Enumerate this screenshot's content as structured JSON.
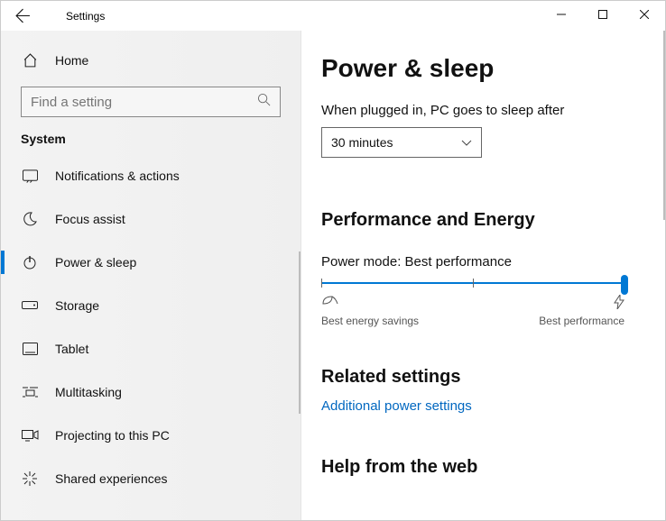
{
  "titlebar": {
    "app_title": "Settings"
  },
  "sidebar": {
    "home_label": "Home",
    "search_placeholder": "Find a setting",
    "category": "System",
    "items": [
      {
        "label": "Notifications & actions",
        "icon": "notifications"
      },
      {
        "label": "Focus assist",
        "icon": "moon"
      },
      {
        "label": "Power & sleep",
        "icon": "power",
        "selected": true
      },
      {
        "label": "Storage",
        "icon": "storage"
      },
      {
        "label": "Tablet",
        "icon": "tablet"
      },
      {
        "label": "Multitasking",
        "icon": "multitasking"
      },
      {
        "label": "Projecting to this PC",
        "icon": "projecting"
      },
      {
        "label": "Shared experiences",
        "icon": "shared"
      }
    ]
  },
  "main": {
    "title": "Power & sleep",
    "sleep_label": "When plugged in, PC goes to sleep after",
    "sleep_value": "30 minutes",
    "perf_heading": "Performance and Energy",
    "power_mode_prefix": "Power mode: ",
    "power_mode_value": "Best performance",
    "slider_left_label": "Best energy savings",
    "slider_right_label": "Best performance",
    "related_heading": "Related settings",
    "related_link": "Additional power settings",
    "help_heading": "Help from the web"
  }
}
